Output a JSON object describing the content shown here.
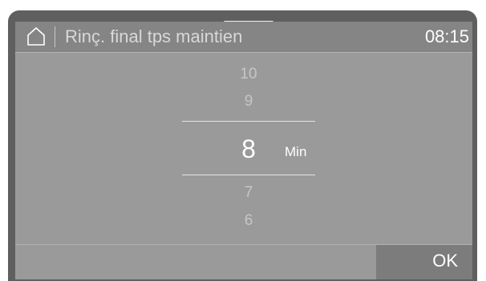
{
  "header": {
    "title": "Rinç. final tps maintien",
    "clock": "08:15"
  },
  "picker": {
    "above": [
      "10",
      "9"
    ],
    "selected": "8",
    "unit": "Min",
    "below": [
      "7",
      "6"
    ]
  },
  "footer": {
    "ok_label": "OK"
  },
  "icons": {
    "home": "home-icon"
  }
}
